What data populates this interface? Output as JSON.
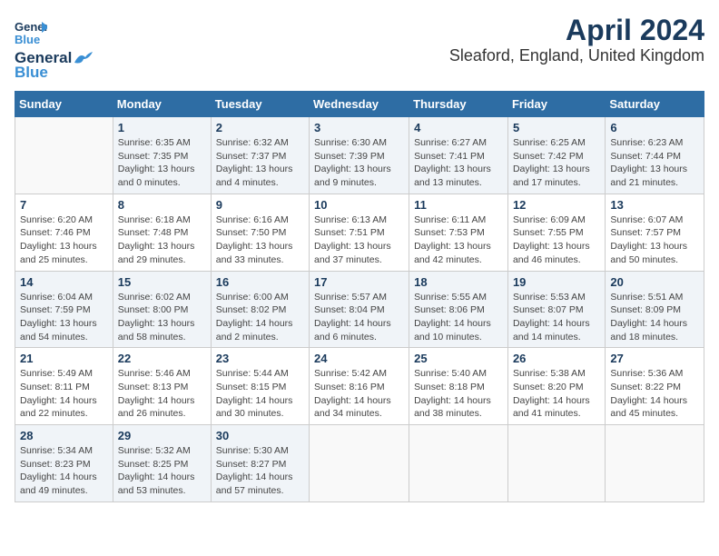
{
  "brand": {
    "name_general": "General",
    "name_blue": "Blue",
    "logo_symbol": "▶"
  },
  "title": "April 2024",
  "subtitle": "Sleaford, England, United Kingdom",
  "days_of_week": [
    "Sunday",
    "Monday",
    "Tuesday",
    "Wednesday",
    "Thursday",
    "Friday",
    "Saturday"
  ],
  "weeks": [
    [
      {
        "day": "",
        "detail": ""
      },
      {
        "day": "1",
        "detail": "Sunrise: 6:35 AM\nSunset: 7:35 PM\nDaylight: 13 hours\nand 0 minutes."
      },
      {
        "day": "2",
        "detail": "Sunrise: 6:32 AM\nSunset: 7:37 PM\nDaylight: 13 hours\nand 4 minutes."
      },
      {
        "day": "3",
        "detail": "Sunrise: 6:30 AM\nSunset: 7:39 PM\nDaylight: 13 hours\nand 9 minutes."
      },
      {
        "day": "4",
        "detail": "Sunrise: 6:27 AM\nSunset: 7:41 PM\nDaylight: 13 hours\nand 13 minutes."
      },
      {
        "day": "5",
        "detail": "Sunrise: 6:25 AM\nSunset: 7:42 PM\nDaylight: 13 hours\nand 17 minutes."
      },
      {
        "day": "6",
        "detail": "Sunrise: 6:23 AM\nSunset: 7:44 PM\nDaylight: 13 hours\nand 21 minutes."
      }
    ],
    [
      {
        "day": "7",
        "detail": "Sunrise: 6:20 AM\nSunset: 7:46 PM\nDaylight: 13 hours\nand 25 minutes."
      },
      {
        "day": "8",
        "detail": "Sunrise: 6:18 AM\nSunset: 7:48 PM\nDaylight: 13 hours\nand 29 minutes."
      },
      {
        "day": "9",
        "detail": "Sunrise: 6:16 AM\nSunset: 7:50 PM\nDaylight: 13 hours\nand 33 minutes."
      },
      {
        "day": "10",
        "detail": "Sunrise: 6:13 AM\nSunset: 7:51 PM\nDaylight: 13 hours\nand 37 minutes."
      },
      {
        "day": "11",
        "detail": "Sunrise: 6:11 AM\nSunset: 7:53 PM\nDaylight: 13 hours\nand 42 minutes."
      },
      {
        "day": "12",
        "detail": "Sunrise: 6:09 AM\nSunset: 7:55 PM\nDaylight: 13 hours\nand 46 minutes."
      },
      {
        "day": "13",
        "detail": "Sunrise: 6:07 AM\nSunset: 7:57 PM\nDaylight: 13 hours\nand 50 minutes."
      }
    ],
    [
      {
        "day": "14",
        "detail": "Sunrise: 6:04 AM\nSunset: 7:59 PM\nDaylight: 13 hours\nand 54 minutes."
      },
      {
        "day": "15",
        "detail": "Sunrise: 6:02 AM\nSunset: 8:00 PM\nDaylight: 13 hours\nand 58 minutes."
      },
      {
        "day": "16",
        "detail": "Sunrise: 6:00 AM\nSunset: 8:02 PM\nDaylight: 14 hours\nand 2 minutes."
      },
      {
        "day": "17",
        "detail": "Sunrise: 5:57 AM\nSunset: 8:04 PM\nDaylight: 14 hours\nand 6 minutes."
      },
      {
        "day": "18",
        "detail": "Sunrise: 5:55 AM\nSunset: 8:06 PM\nDaylight: 14 hours\nand 10 minutes."
      },
      {
        "day": "19",
        "detail": "Sunrise: 5:53 AM\nSunset: 8:07 PM\nDaylight: 14 hours\nand 14 minutes."
      },
      {
        "day": "20",
        "detail": "Sunrise: 5:51 AM\nSunset: 8:09 PM\nDaylight: 14 hours\nand 18 minutes."
      }
    ],
    [
      {
        "day": "21",
        "detail": "Sunrise: 5:49 AM\nSunset: 8:11 PM\nDaylight: 14 hours\nand 22 minutes."
      },
      {
        "day": "22",
        "detail": "Sunrise: 5:46 AM\nSunset: 8:13 PM\nDaylight: 14 hours\nand 26 minutes."
      },
      {
        "day": "23",
        "detail": "Sunrise: 5:44 AM\nSunset: 8:15 PM\nDaylight: 14 hours\nand 30 minutes."
      },
      {
        "day": "24",
        "detail": "Sunrise: 5:42 AM\nSunset: 8:16 PM\nDaylight: 14 hours\nand 34 minutes."
      },
      {
        "day": "25",
        "detail": "Sunrise: 5:40 AM\nSunset: 8:18 PM\nDaylight: 14 hours\nand 38 minutes."
      },
      {
        "day": "26",
        "detail": "Sunrise: 5:38 AM\nSunset: 8:20 PM\nDaylight: 14 hours\nand 41 minutes."
      },
      {
        "day": "27",
        "detail": "Sunrise: 5:36 AM\nSunset: 8:22 PM\nDaylight: 14 hours\nand 45 minutes."
      }
    ],
    [
      {
        "day": "28",
        "detail": "Sunrise: 5:34 AM\nSunset: 8:23 PM\nDaylight: 14 hours\nand 49 minutes."
      },
      {
        "day": "29",
        "detail": "Sunrise: 5:32 AM\nSunset: 8:25 PM\nDaylight: 14 hours\nand 53 minutes."
      },
      {
        "day": "30",
        "detail": "Sunrise: 5:30 AM\nSunset: 8:27 PM\nDaylight: 14 hours\nand 57 minutes."
      },
      {
        "day": "",
        "detail": ""
      },
      {
        "day": "",
        "detail": ""
      },
      {
        "day": "",
        "detail": ""
      },
      {
        "day": "",
        "detail": ""
      }
    ]
  ]
}
